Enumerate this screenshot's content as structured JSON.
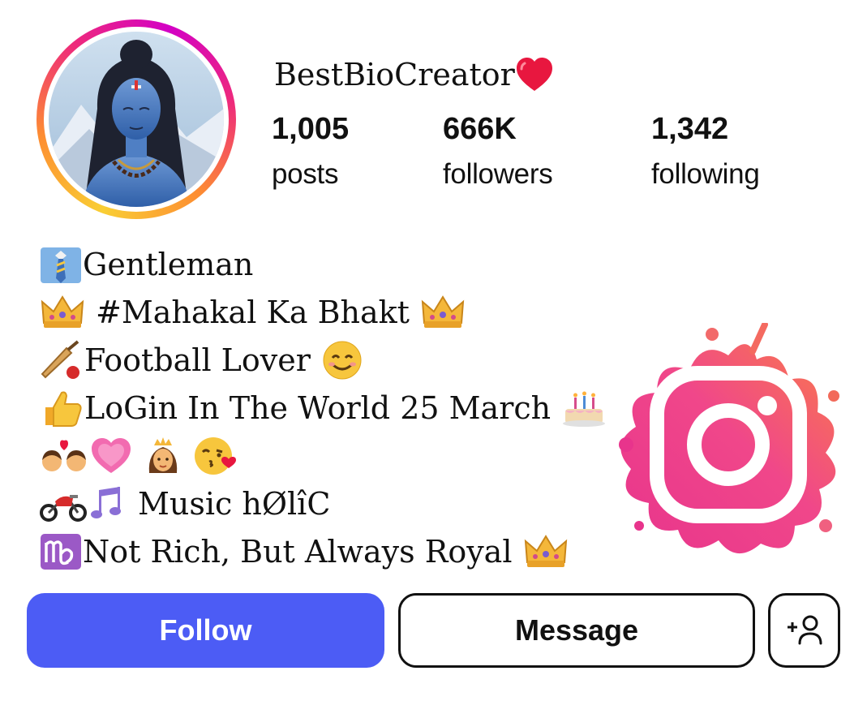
{
  "profile": {
    "username": "BestBioCreator",
    "username_icon": "red-heart-icon",
    "avatar_icon": "shiva-portrait-avatar"
  },
  "stats": [
    {
      "value": "1,005",
      "label": "posts"
    },
    {
      "value": "666K",
      "label": "followers"
    },
    {
      "value": "1,342",
      "label": "following"
    }
  ],
  "bio": {
    "lines": [
      {
        "icons": [
          "necktie-icon"
        ],
        "text": "Gentleman"
      },
      {
        "icons": [
          "crown-icon"
        ],
        "text": "#Mahakal Ka Bhakt",
        "trailing_icons": [
          "crown-icon"
        ]
      },
      {
        "icons": [
          "cricket-bat-icon"
        ],
        "text": "Football Lover",
        "trailing_icons": [
          "smiling-face-icon"
        ]
      },
      {
        "icons": [
          "thumbs-up-icon"
        ],
        "text": "LoGin In The World 25 March",
        "trailing_icons": [
          "birthday-cake-icon"
        ]
      },
      {
        "icons": [
          "couple-with-heart-icon",
          "growing-heart-icon",
          "princess-icon",
          "face-blowing-kiss-icon"
        ],
        "text": ""
      },
      {
        "icons": [
          "motorcycle-icon",
          "music-notes-icon"
        ],
        "text": "Music hØlîC"
      },
      {
        "icons": [
          "virgo-icon"
        ],
        "text": "Not Rich, But Always Royal",
        "trailing_icons": [
          "crown-icon"
        ]
      }
    ]
  },
  "actions": {
    "follow_label": "Follow",
    "message_label": "Message",
    "add_user_icon": "add-person-icon"
  },
  "brand": {
    "logo": "instagram-splash-logo"
  },
  "colors": {
    "follow_button": "#4c5cf5",
    "heart": "#e8173f",
    "ring_gradient": [
      "#f9ce34",
      "#ee2a7b",
      "#d300c5"
    ]
  }
}
